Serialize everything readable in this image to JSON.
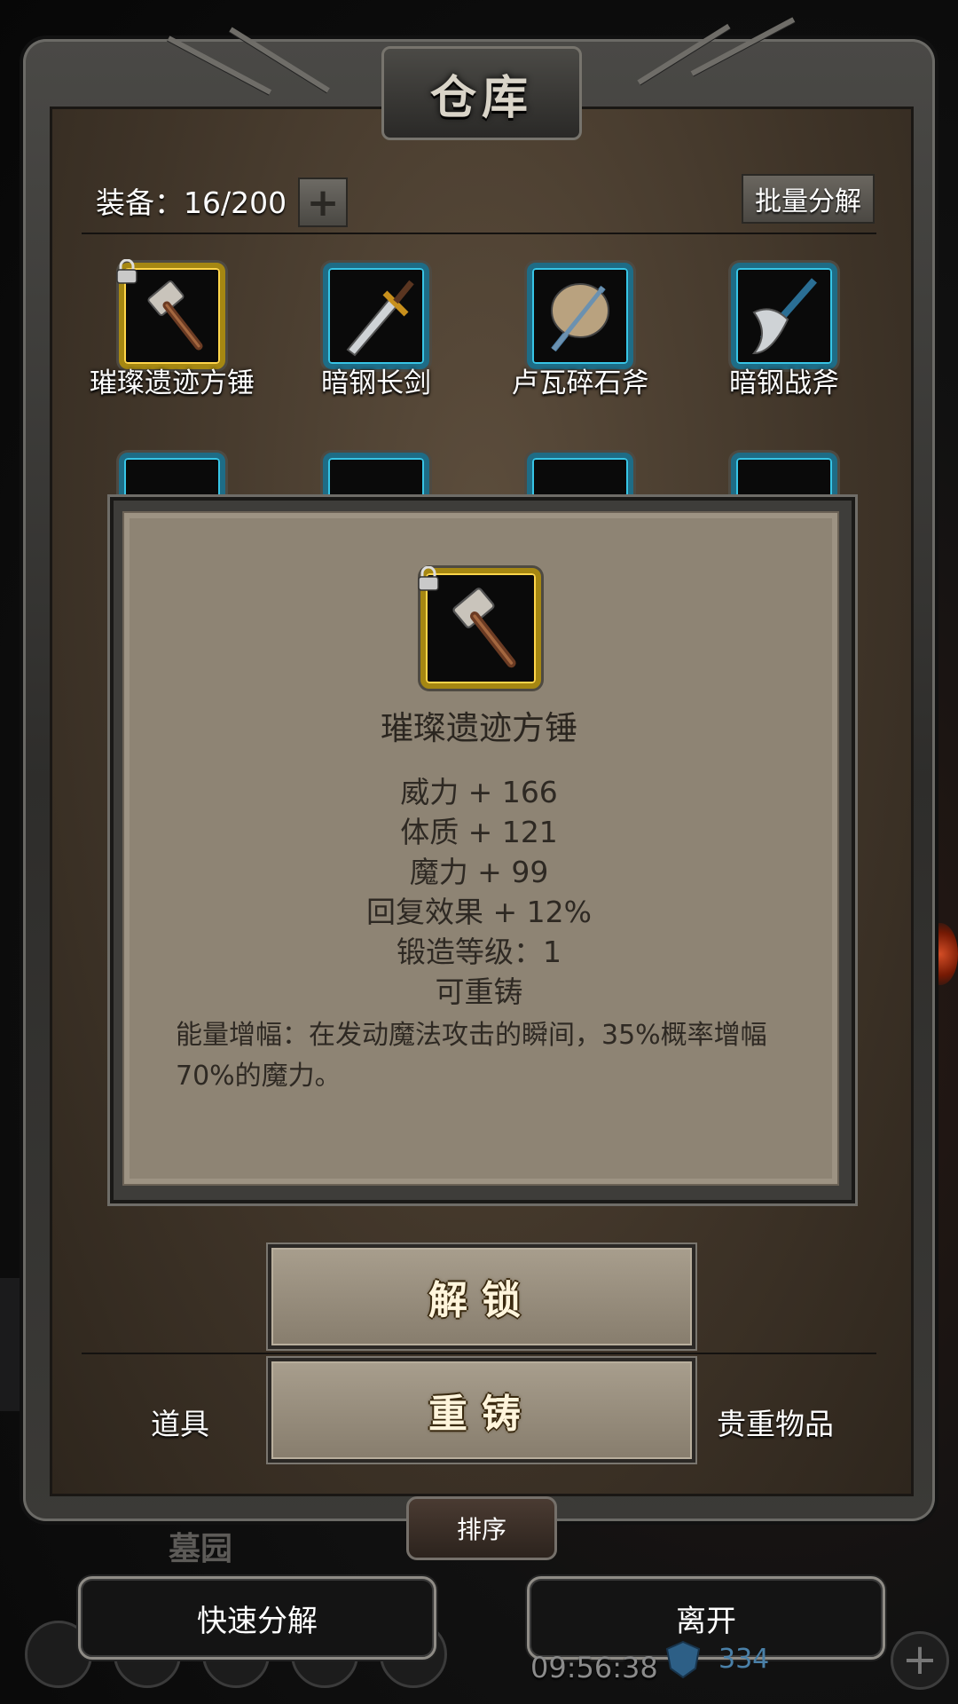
{
  "header": {
    "title": "仓库",
    "equip_label": "装备：16/200",
    "add_capacity_symbol": "+",
    "batch_decompose": "批量分解"
  },
  "grid": {
    "row1": [
      {
        "name": "璀璨遗迹方锤",
        "rarity": "gold",
        "locked": true,
        "icon": "hammer-icon"
      },
      {
        "name": "暗钢长剑",
        "rarity": "blue",
        "locked": false,
        "icon": "sword-icon"
      },
      {
        "name": "卢瓦碎石斧",
        "rarity": "blue",
        "locked": false,
        "icon": "double-axe-icon"
      },
      {
        "name": "暗钢战斧",
        "rarity": "blue",
        "locked": false,
        "icon": "battle-axe-icon"
      }
    ]
  },
  "detail": {
    "name": "璀璨遗迹方锤",
    "stats": [
      "威力 + 166",
      "体质 + 121",
      "魔力 + 99",
      "回复效果 + 12%",
      "锻造等级：1",
      "可重铸"
    ],
    "description": "能量增幅：在发动魔法攻击的瞬间，35%概率增幅70%的魔力。"
  },
  "actions": {
    "unlock": "解锁",
    "reforge": "重铸"
  },
  "tabs": {
    "items": "道具",
    "valuables": "贵重物品"
  },
  "bottom": {
    "sort": "排序",
    "background_label": "墓园",
    "quick_decompose": "快速分解",
    "leave": "离开",
    "clock": "09:56:38",
    "gems": "334"
  },
  "colors": {
    "gold_frame": "#a58712",
    "blue_frame": "#1e6c86",
    "popup_bg": "#8e8474"
  }
}
